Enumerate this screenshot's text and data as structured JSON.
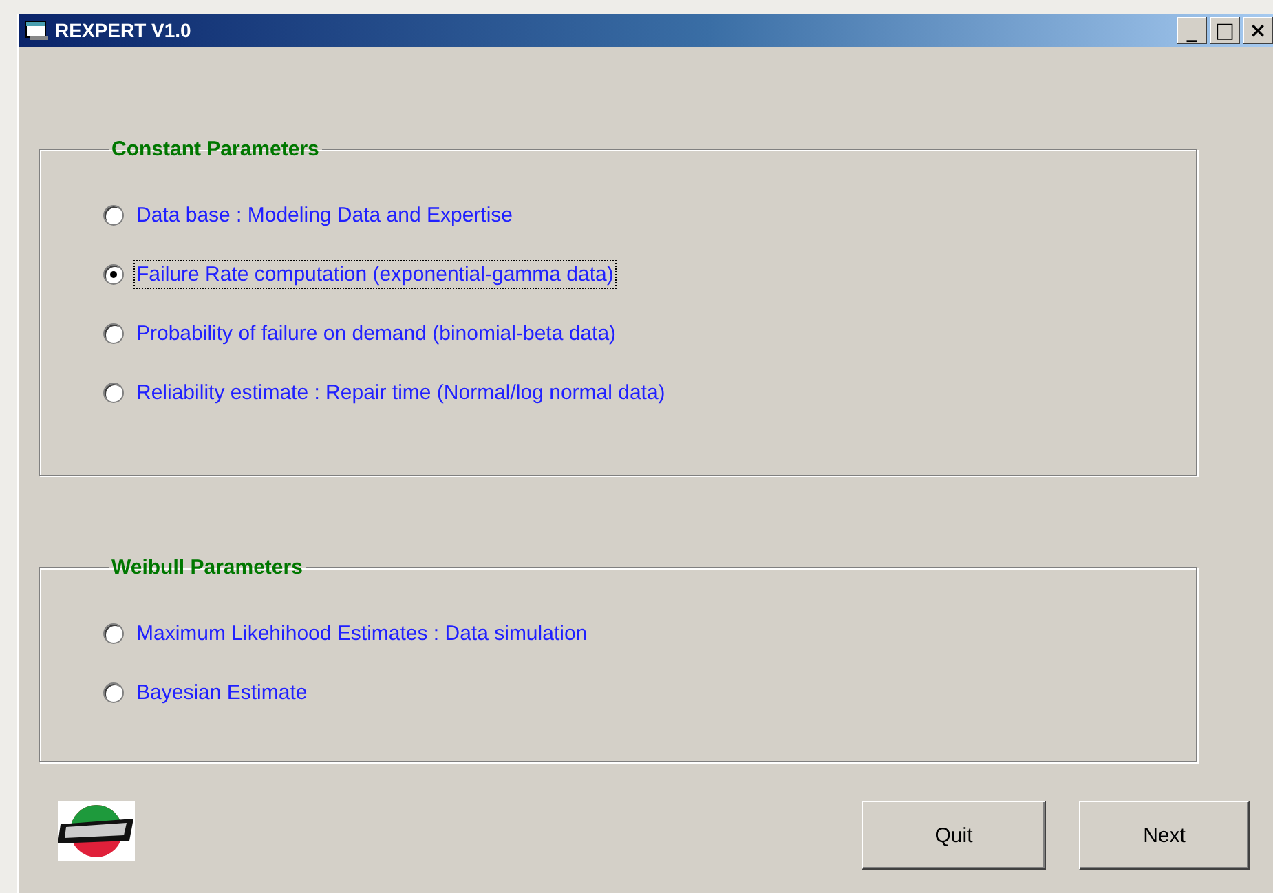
{
  "window": {
    "title": "REXPERT V1.0",
    "controls": [
      "_",
      "□",
      "×"
    ]
  },
  "groups": [
    {
      "title": "Constant Parameters",
      "options": [
        {
          "label": "Data base : Modeling Data and Expertise",
          "selected": false
        },
        {
          "label": "Failure Rate computation (exponential-gamma data)",
          "selected": true
        },
        {
          "label": "Probability of failure on demand (binomial-beta data)",
          "selected": false
        },
        {
          "label": "Reliability estimate : Repair time (Normal/log normal data)",
          "selected": false
        }
      ]
    },
    {
      "title": "Weibull Parameters",
      "options": [
        {
          "label": "Maximum Likehihood Estimates : Data simulation",
          "selected": false
        },
        {
          "label": "Bayesian Estimate",
          "selected": false
        }
      ]
    }
  ],
  "buttons": [
    "Quit",
    "Next"
  ]
}
